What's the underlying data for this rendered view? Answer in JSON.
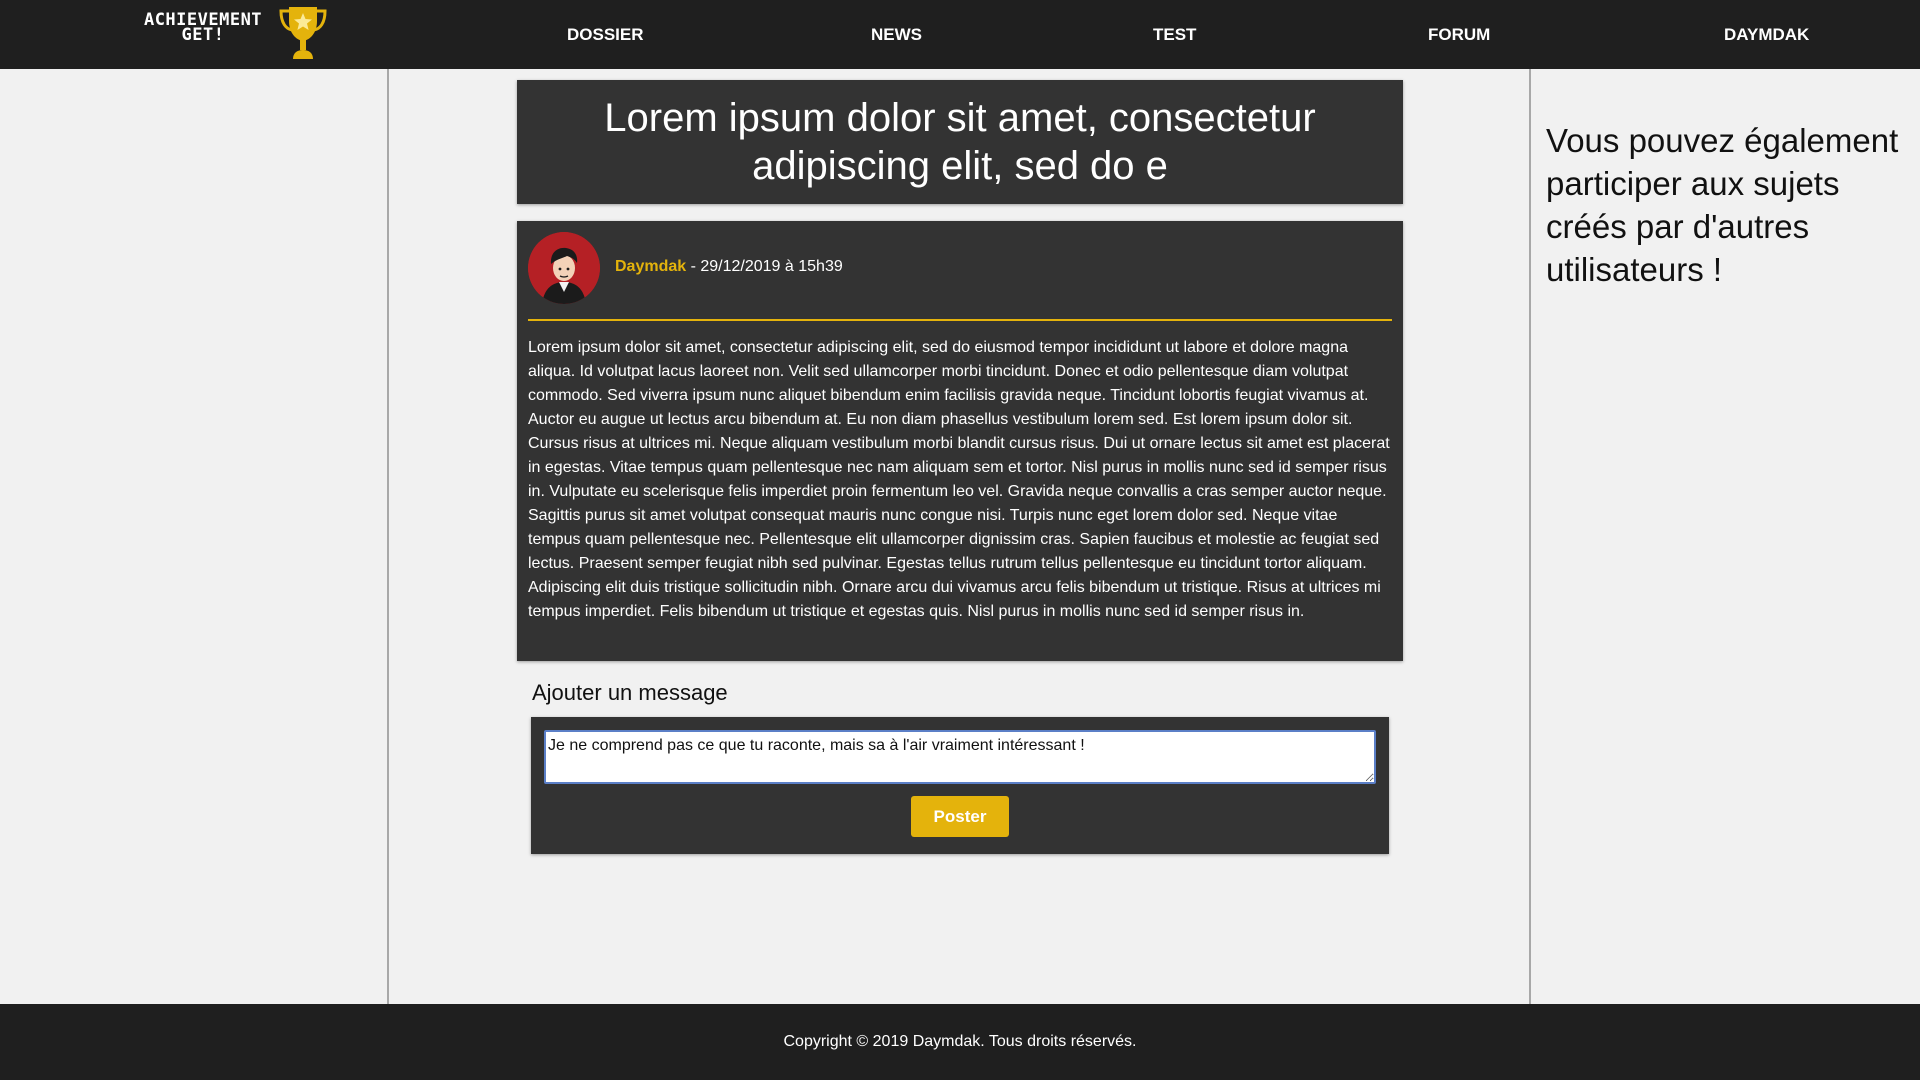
{
  "logo": {
    "line1": "ACHIEVEMENT",
    "line2": "GET!",
    "icon": "trophy-icon",
    "trophy_color": "#e4b30c"
  },
  "nav": {
    "items": [
      {
        "label": "DOSSIER"
      },
      {
        "label": "NEWS"
      },
      {
        "label": "TEST"
      },
      {
        "label": "FORUM"
      },
      {
        "label": "DAYMDAK"
      }
    ]
  },
  "topic": {
    "title": "Lorem ipsum dolor sit amet, consectetur adipiscing elit, sed do e"
  },
  "post": {
    "author": "Daymdak",
    "date": " - 29/12/2019 à 15h39",
    "avatar_icon": "avatar-icon",
    "body": "Lorem ipsum dolor sit amet, consectetur adipiscing elit, sed do eiusmod tempor incididunt ut labore et dolore magna aliqua. Id volutpat lacus laoreet non. Velit sed ullamcorper morbi tincidunt. Donec et odio pellentesque diam volutpat commodo. Sed viverra ipsum nunc aliquet bibendum enim facilisis gravida neque. Tincidunt lobortis feugiat vivamus at. Auctor eu augue ut lectus arcu bibendum at. Eu non diam phasellus vestibulum lorem sed. Est lorem ipsum dolor sit. Cursus risus at ultrices mi. Neque aliquam vestibulum morbi blandit cursus risus. Dui ut ornare lectus sit amet est placerat in egestas. Vitae tempus quam pellentesque nec nam aliquam sem et tortor. Nisl purus in mollis nunc sed id semper risus in. Vulputate eu scelerisque felis imperdiet proin fermentum leo vel. Gravida neque convallis a cras semper auctor neque. Sagittis purus sit amet volutpat consequat mauris nunc congue nisi. Turpis nunc eget lorem dolor sed. Neque vitae tempus quam pellentesque nec. Pellentesque elit ullamcorper dignissim cras. Sapien faucibus et molestie ac feugiat sed lectus. Praesent semper feugiat nibh sed pulvinar. Egestas tellus rutrum tellus pellentesque eu tincidunt tortor aliquam. Adipiscing elit duis tristique sollicitudin nibh. Ornare arcu dui vivamus arcu felis bibendum ut tristique. Risus at ultrices mi tempus imperdiet. Felis bibendum ut tristique et egestas quis. Nisl purus in mollis nunc sed id semper risus in."
  },
  "reply": {
    "heading": "Ajouter un message",
    "value": "Je ne comprend pas ce que tu raconte, mais sa à l'air vraiment intéressant !",
    "button_label": "Poster"
  },
  "aside": {
    "text": "Vous pouvez également participer aux sujets créés par d'autres utilisateurs !"
  },
  "footer": {
    "text": "Copyright © 2019 Daymdak. Tous droits réservés."
  },
  "colors": {
    "accent": "#e4b30c",
    "dark_panel": "#333333",
    "top_bar": "#1f1f1f",
    "avatar_bg": "#b52025"
  }
}
